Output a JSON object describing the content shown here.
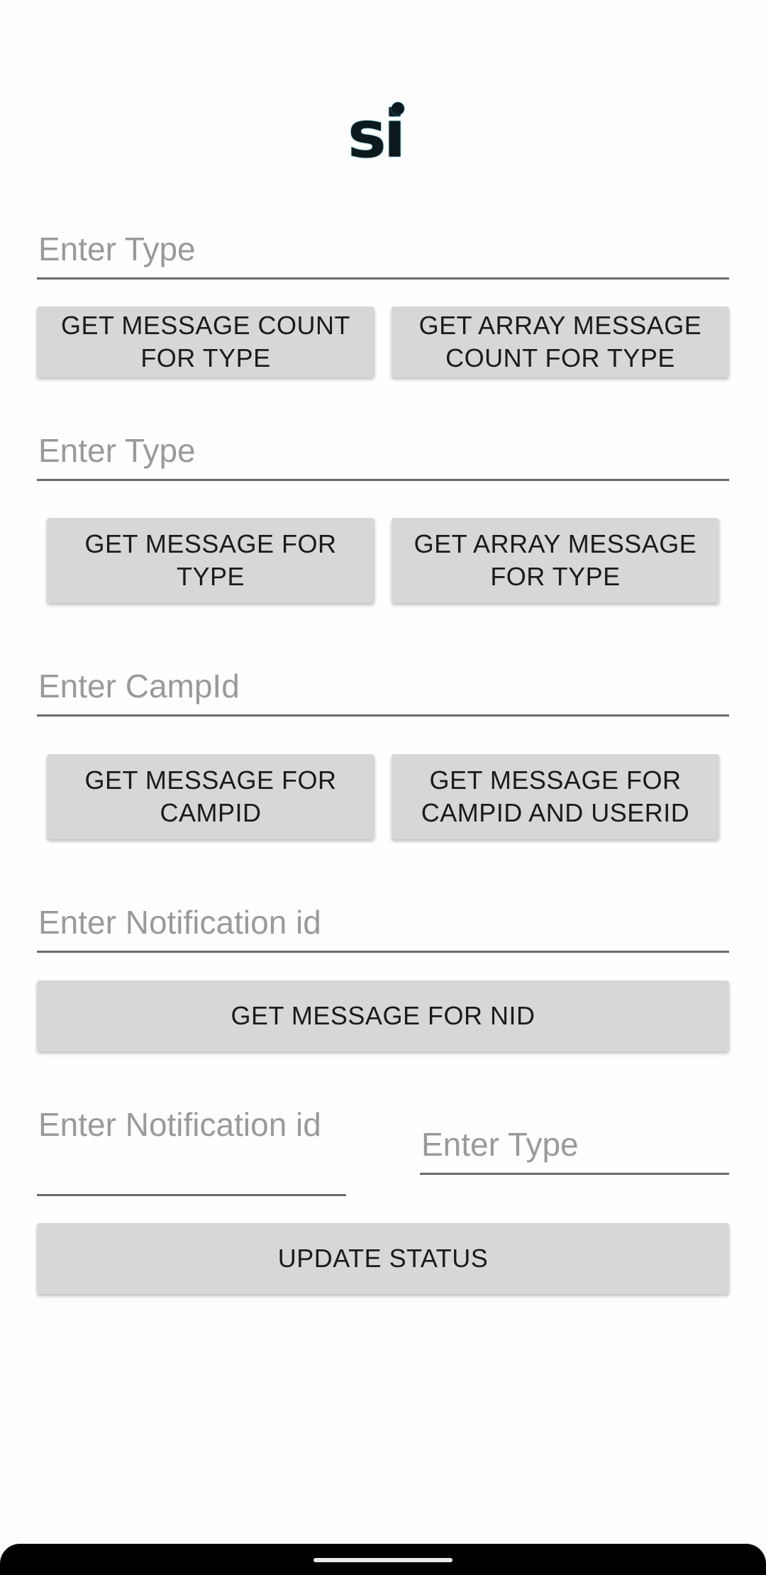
{
  "logo": {
    "text": "si"
  },
  "sections": {
    "type_count": {
      "placeholder": "Enter Type",
      "btn_count": "GET MESSAGE COUNT FOR TYPE",
      "btn_array_count": "GET ARRAY MESSAGE COUNT FOR TYPE"
    },
    "type_message": {
      "placeholder": "Enter Type",
      "btn_message": "GET MESSAGE FOR TYPE",
      "btn_array_message": "GET ARRAY MESSAGE FOR TYPE"
    },
    "campid": {
      "placeholder": "Enter CampId",
      "btn_campid": "GET MESSAGE FOR CAMPID",
      "btn_campid_userid": "GET MESSAGE FOR CAMPID AND USERID"
    },
    "nid": {
      "placeholder": "Enter Notification id",
      "btn_nid": "GET MESSAGE FOR NID"
    },
    "update": {
      "placeholder_nid": "Enter Notification id",
      "placeholder_type": "Enter Type",
      "btn_update": "UPDATE STATUS"
    }
  }
}
